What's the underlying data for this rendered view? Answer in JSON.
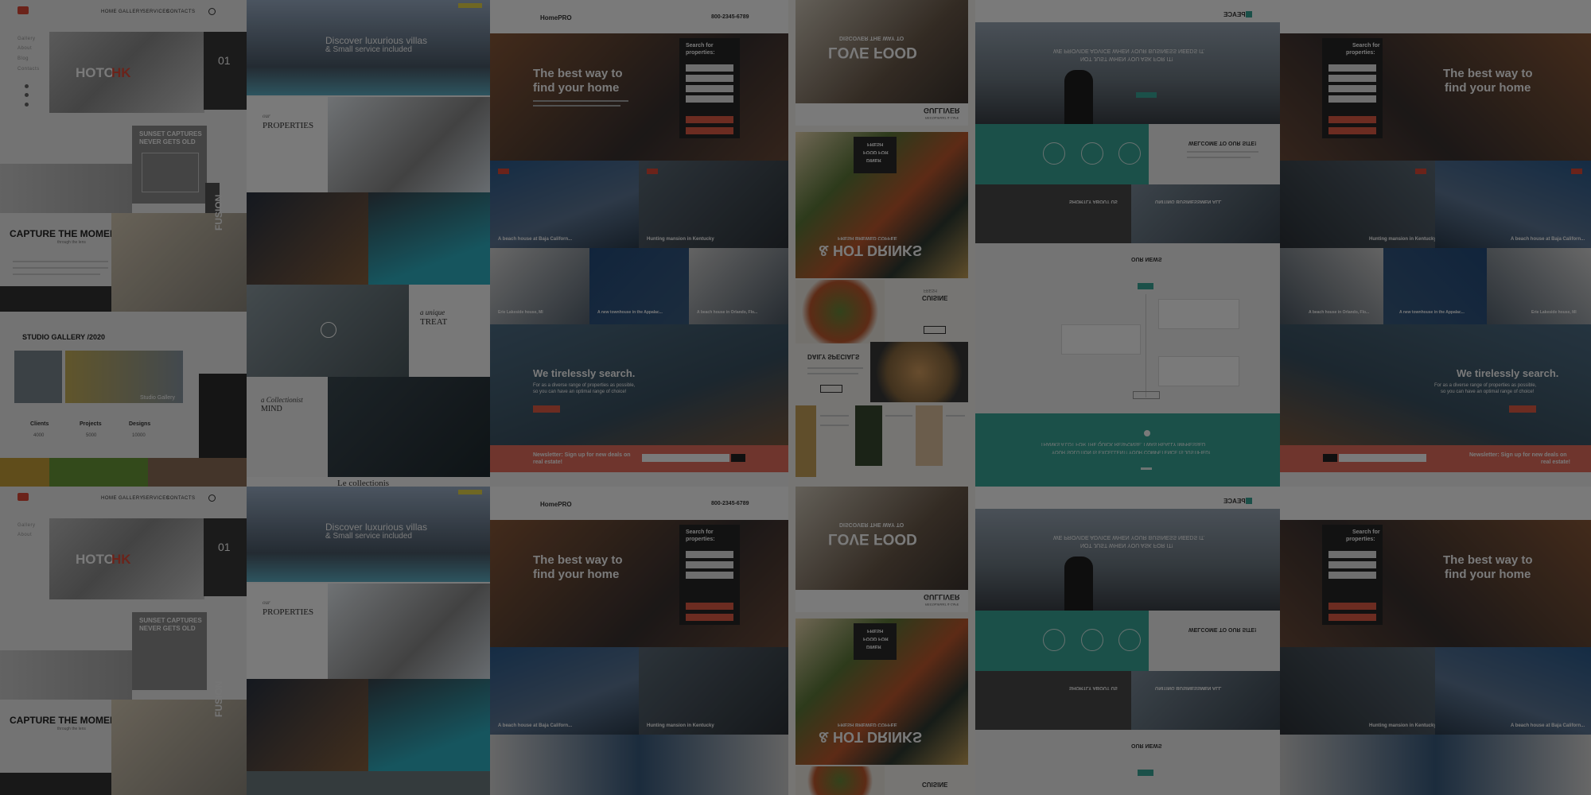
{
  "colors": {
    "overlay": "#000000",
    "teal": "#3aa89a",
    "coral": "#e8705f",
    "red": "#e0463a",
    "photo_pink": "#e25c45"
  },
  "photo_template": {
    "logo_icon": "camera-icon",
    "nav": [
      "HOME",
      "GALLERY",
      "SERVICES",
      "CONTACTS"
    ],
    "search_icon": "search-icon",
    "side_menu": [
      "Gallery",
      "About",
      "Blog",
      "Contacts"
    ],
    "brand_left": "HOTO",
    "brand_right": "HK",
    "slide_number": "01",
    "sunset_heading_1": "SUNSET CAPTURES",
    "sunset_heading_2": "NEVER GETS OLD",
    "capture_heading": "CAPTURE THE MOMENT",
    "capture_sub": "through the lens",
    "fusion": "FUSION",
    "gallery_heading": "STUDIO GALLERY /2020",
    "gallery_caption": "Studio Gallery",
    "stats": [
      {
        "label": "Clients",
        "value": "4000"
      },
      {
        "label": "Projects",
        "value": "5000"
      },
      {
        "label": "Designs",
        "value": "10000"
      }
    ]
  },
  "villas_template": {
    "hero_line_1": "Discover luxurious villas",
    "hero_line_2": "& Small service included",
    "properties_kicker": "our",
    "properties_heading": "PROPERTIES",
    "treat_1": "a unique",
    "treat_2": "TREAT",
    "mind_1": "a Collectionist",
    "mind_2": "MIND",
    "bottom_heading": "Le collectionis"
  },
  "home_template": {
    "logo": "HomePRO",
    "phone": "800-2345-6789",
    "hero_line_1": "The best way to",
    "hero_line_2": "find your home",
    "search_heading_1": "Search for",
    "search_heading_2": "properties:",
    "captions": [
      "A beach house at Baja Californ...",
      "Hunting mansion in Kentucky"
    ],
    "captions_2": [
      "Erie Lakeside house, MI",
      "A new townhouse in the Appalac...",
      "A beach house in Orlando, Flo..."
    ],
    "search_heading_main": "We tirelessly search.",
    "search_sub_1": "For as a diverse range of properties as possible,",
    "search_sub_2": "so you can have an optimal range of choice!",
    "newsletter_1": "Newsletter: Sign up for new deals on",
    "newsletter_2": "real estate!"
  },
  "restaurant_template": {
    "kicker": "DISCOVER THE WAY TO",
    "love_food": "LOVE FOOD",
    "brand": "GULLIVER",
    "brand_sub": "RESTAURANT & CAFE",
    "drinks_kicker": "FRESH BREWED COFFEE",
    "drinks": "& HOT DRINKS",
    "badge_1": "FRESH",
    "badge_2": "FOOD FOR",
    "badge_3": "DINER",
    "cuisine_kicker": "FRESH",
    "cuisine": "CUISINE",
    "specials": "DAILY SPECIALS"
  },
  "peace_template": {
    "brand": "PEACE",
    "hero_1": "WE PROVIDE ADVICE WHEN YOUR BUSINESS NEEDS IT.",
    "hero_2": "NOT JUST WHEN YOU ASK FOR IT!",
    "welcome": "WELCOME TO OUR SITE!",
    "about": "SHORTLY ABOUT US",
    "uniting": "UNITING BUSINESSMEN ALL",
    "news": "OUR NEWS",
    "quote_1": "THANKS A LOT FOR THE QUICK RESPONSE. I WAS REALLY IMPRESSED",
    "quote_2": "YOUR SOLUTION IS EXCELLENT! YOUR COMPETENCE IS JUSTIFIED!"
  },
  "mirror_home_template": {
    "hero_line_1": "The best way to",
    "hero_line_2": "find your home",
    "search_heading_1": "Search for",
    "search_heading_2": "properties:",
    "captions": [
      "Hunting mansion in Kentucky",
      "A beach house at Baja Californ..."
    ],
    "captions_2": [
      "A beach house in Orlando, Flo...",
      "A new townhouse in the Appalac...",
      "Erie Lakeside house, MI"
    ],
    "search_heading_main": "We tirelessly search.",
    "search_sub_1": "For as a diverse range of properties as possible,",
    "search_sub_2": "so you can have an optimal range of choice!",
    "newsletter_1": "Newsletter: Sign up for new deals on",
    "newsletter_2": "real estate!"
  }
}
